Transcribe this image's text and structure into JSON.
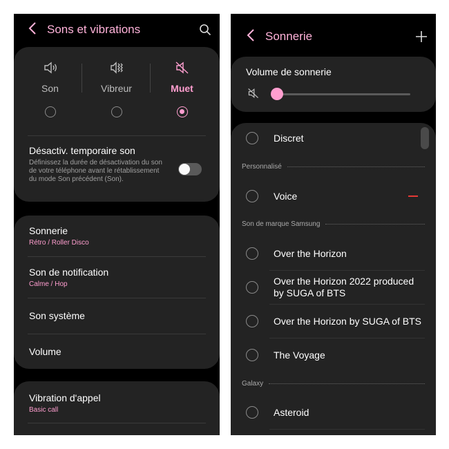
{
  "left": {
    "header": {
      "title": "Sons et vibrations",
      "back_icon": "chevron-left-icon",
      "search_icon": "search-icon"
    },
    "modes": [
      {
        "label": "Son",
        "icon": "speaker-icon",
        "selected": false
      },
      {
        "label": "Vibreur",
        "icon": "vibrate-icon",
        "selected": false
      },
      {
        "label": "Muet",
        "icon": "mute-icon",
        "selected": true
      }
    ],
    "temp_mute": {
      "title": "Désactiv. temporaire son",
      "description": "Définissez la durée de désactivation du son de votre téléphone avant le rétablissement du mode Son précédent (Son).",
      "enabled": false
    },
    "items": [
      {
        "title": "Sonnerie",
        "subtitle": "Rétro / Roller Disco"
      },
      {
        "title": "Son de notification",
        "subtitle": "Calme / Hop"
      },
      {
        "title": "Son système",
        "subtitle": ""
      },
      {
        "title": "Volume",
        "subtitle": ""
      }
    ],
    "vibration": {
      "title": "Vibration d'appel",
      "subtitle": "Basic call"
    }
  },
  "right": {
    "header": {
      "title": "Sonnerie",
      "back_icon": "chevron-left-icon",
      "add_icon": "plus-icon"
    },
    "volume": {
      "title": "Volume de sonnerie",
      "level": 0.0,
      "icon": "mute-icon"
    },
    "first_item": "Discret",
    "sections": [
      {
        "name": "Personnalisé",
        "items": [
          "Voice"
        ]
      },
      {
        "name": "Son de marque Samsung",
        "items": [
          "Over the Horizon",
          "Over the Horizon 2022 produced by SUGA of BTS",
          "Over the Horizon by SUGA of BTS",
          "The Voyage"
        ]
      },
      {
        "name": "Galaxy",
        "items": [
          "Asteroid"
        ]
      }
    ]
  },
  "colors": {
    "accent": "#ff9ecf",
    "background": "#000000",
    "card": "#232323",
    "remove": "#e53935"
  }
}
